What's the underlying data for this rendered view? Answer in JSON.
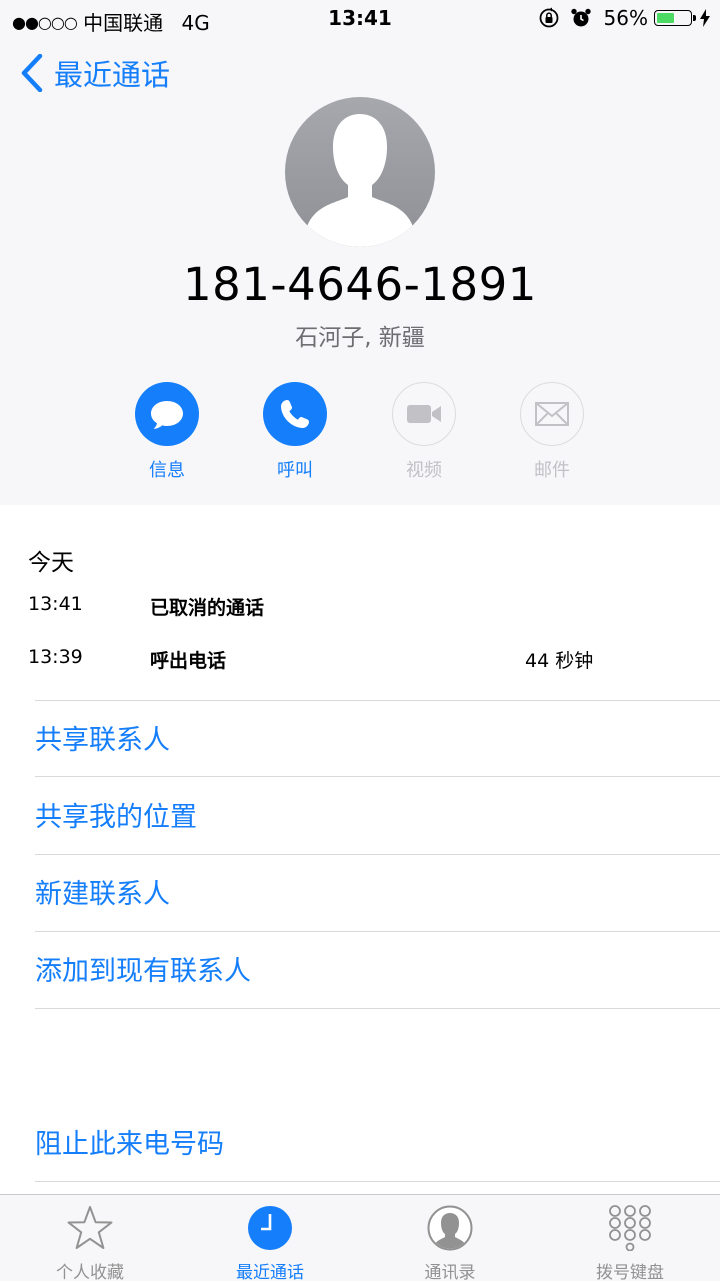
{
  "status_bar": {
    "signal_dots": "●●○○○",
    "carrier": "中国联通",
    "network": "4G",
    "time": "13:41",
    "battery_percent": "56%",
    "battery_level": 0.56
  },
  "nav": {
    "back_label": "最近通话"
  },
  "contact": {
    "number": "181-4646-1891",
    "location": "石河子, 新疆"
  },
  "actions": [
    {
      "label": "信息",
      "icon": "message-icon",
      "enabled": true
    },
    {
      "label": "呼叫",
      "icon": "phone-icon",
      "enabled": true
    },
    {
      "label": "视频",
      "icon": "video-icon",
      "enabled": false
    },
    {
      "label": "邮件",
      "icon": "mail-icon",
      "enabled": false
    }
  ],
  "history": {
    "section_title": "今天",
    "calls": [
      {
        "time": "13:41",
        "kind": "已取消的通话",
        "duration": ""
      },
      {
        "time": "13:39",
        "kind": "呼出电话",
        "duration": "44 秒钟"
      }
    ]
  },
  "menu": [
    "共享联系人",
    "共享我的位置",
    "新建联系人",
    "添加到现有联系人"
  ],
  "block": "阻止此来电号码",
  "tabs": [
    {
      "label": "个人收藏",
      "icon": "star-icon",
      "active": false
    },
    {
      "label": "最近通话",
      "icon": "clock-icon",
      "active": true
    },
    {
      "label": "通讯录",
      "icon": "contacts-icon",
      "active": false
    },
    {
      "label": "拨号键盘",
      "icon": "keypad-icon",
      "active": false
    }
  ],
  "colors": {
    "accent": "#157efb",
    "header_bg": "#f7f7f9",
    "disabled": "#c2c2c6",
    "battery_green": "#4cd964"
  }
}
